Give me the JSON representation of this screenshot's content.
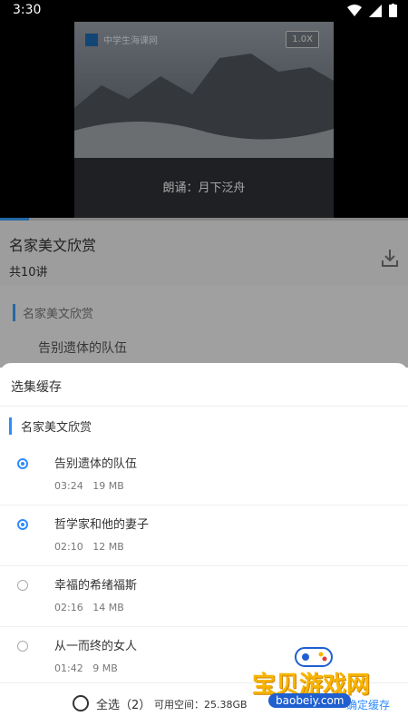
{
  "status_bar": {
    "time": "3:30"
  },
  "video": {
    "logo_text": "中学生海课网",
    "speed_label": "1.0X",
    "caption": "朗诵：月下泛舟",
    "progress": 0.07
  },
  "course": {
    "title": "名家美文欣赏",
    "lecture_count": "共10讲"
  },
  "background_list": {
    "section_title": "名家美文欣赏",
    "first_item": "告别遗体的队伍"
  },
  "sheet": {
    "header": "选集缓存",
    "section_title": "名家美文欣赏",
    "items": [
      {
        "name": "告别遗体的队伍",
        "duration": "03:24",
        "size": "19 MB",
        "selected": true
      },
      {
        "name": "哲学家和他的妻子",
        "duration": "02:10",
        "size": "12 MB",
        "selected": true
      },
      {
        "name": "幸福的希绪福斯",
        "duration": "02:16",
        "size": "14 MB",
        "selected": false
      },
      {
        "name": "从一而终的女人",
        "duration": "01:42",
        "size": "9 MB",
        "selected": false
      }
    ],
    "footer": {
      "select_all": "全选（2）",
      "available_space": "可用空间：25.38GB",
      "confirm": "确定缓存"
    }
  },
  "watermark": {
    "title": "宝贝游戏网",
    "url": "baobeiy.com"
  },
  "colors": {
    "accent": "#2f8cff",
    "watermark_yellow": "#f7b500"
  }
}
